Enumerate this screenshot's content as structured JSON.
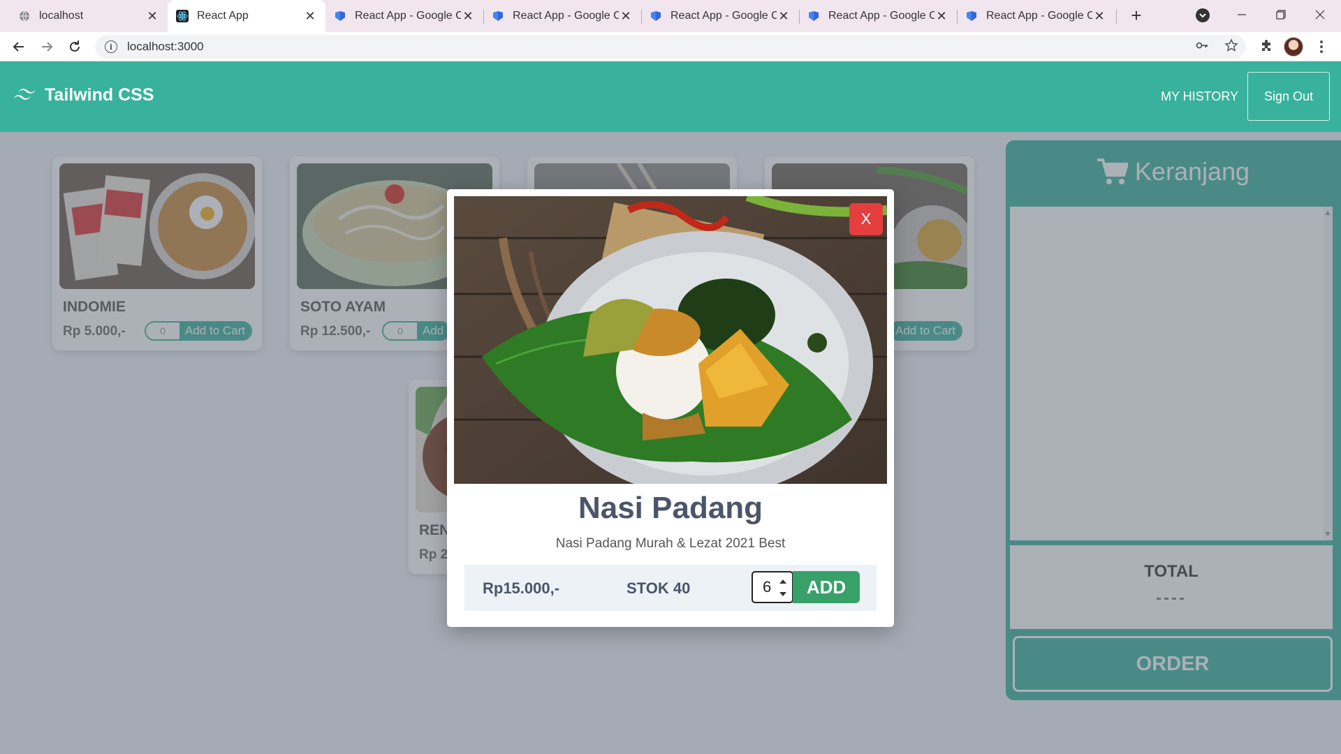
{
  "browser": {
    "tabs": [
      {
        "title": "localhost",
        "favicon": "globe-icon",
        "active": false
      },
      {
        "title": "React App",
        "favicon": "react-icon",
        "active": true
      },
      {
        "title": "React App - Google C",
        "favicon": "google-cloud-icon",
        "active": false
      },
      {
        "title": "React App - Google C",
        "favicon": "google-cloud-icon",
        "active": false
      },
      {
        "title": "React App - Google C",
        "favicon": "google-cloud-icon",
        "active": false
      },
      {
        "title": "React App - Google C",
        "favicon": "google-cloud-icon",
        "active": false
      },
      {
        "title": "React App - Google C",
        "favicon": "google-cloud-icon",
        "active": false
      }
    ],
    "url": "localhost:3000"
  },
  "navbar": {
    "brand": "Tailwind CSS",
    "history_label": "MY HISTORY",
    "signout_label": "Sign Out"
  },
  "products": [
    {
      "name": "INDOMIE",
      "price": "Rp 5.000,-",
      "qty": "0",
      "button": "Add to Cart"
    },
    {
      "name": "SOTO AYAM",
      "price": "Rp 12.500,-",
      "qty": "0",
      "button": "Add"
    },
    {
      "name": "",
      "price": "",
      "qty": "",
      "button": ""
    },
    {
      "name": "",
      "price": "",
      "qty": "",
      "button": "Add to Cart"
    },
    {
      "name": "REN",
      "price": "Rp 2",
      "qty": "",
      "button": ""
    }
  ],
  "cart": {
    "title": "Keranjang",
    "total_label": "TOTAL",
    "total_value": "----",
    "order_label": "ORDER"
  },
  "modal": {
    "close_label": "X",
    "title": "Nasi Padang",
    "description": "Nasi Padang Murah & Lezat 2021 Best",
    "price": "Rp15.000,-",
    "stock": "STOK 40",
    "qty": "6",
    "add_label": "ADD"
  },
  "colors": {
    "primary": "#38b29c",
    "close": "#e53e3e",
    "add": "#38a169"
  }
}
